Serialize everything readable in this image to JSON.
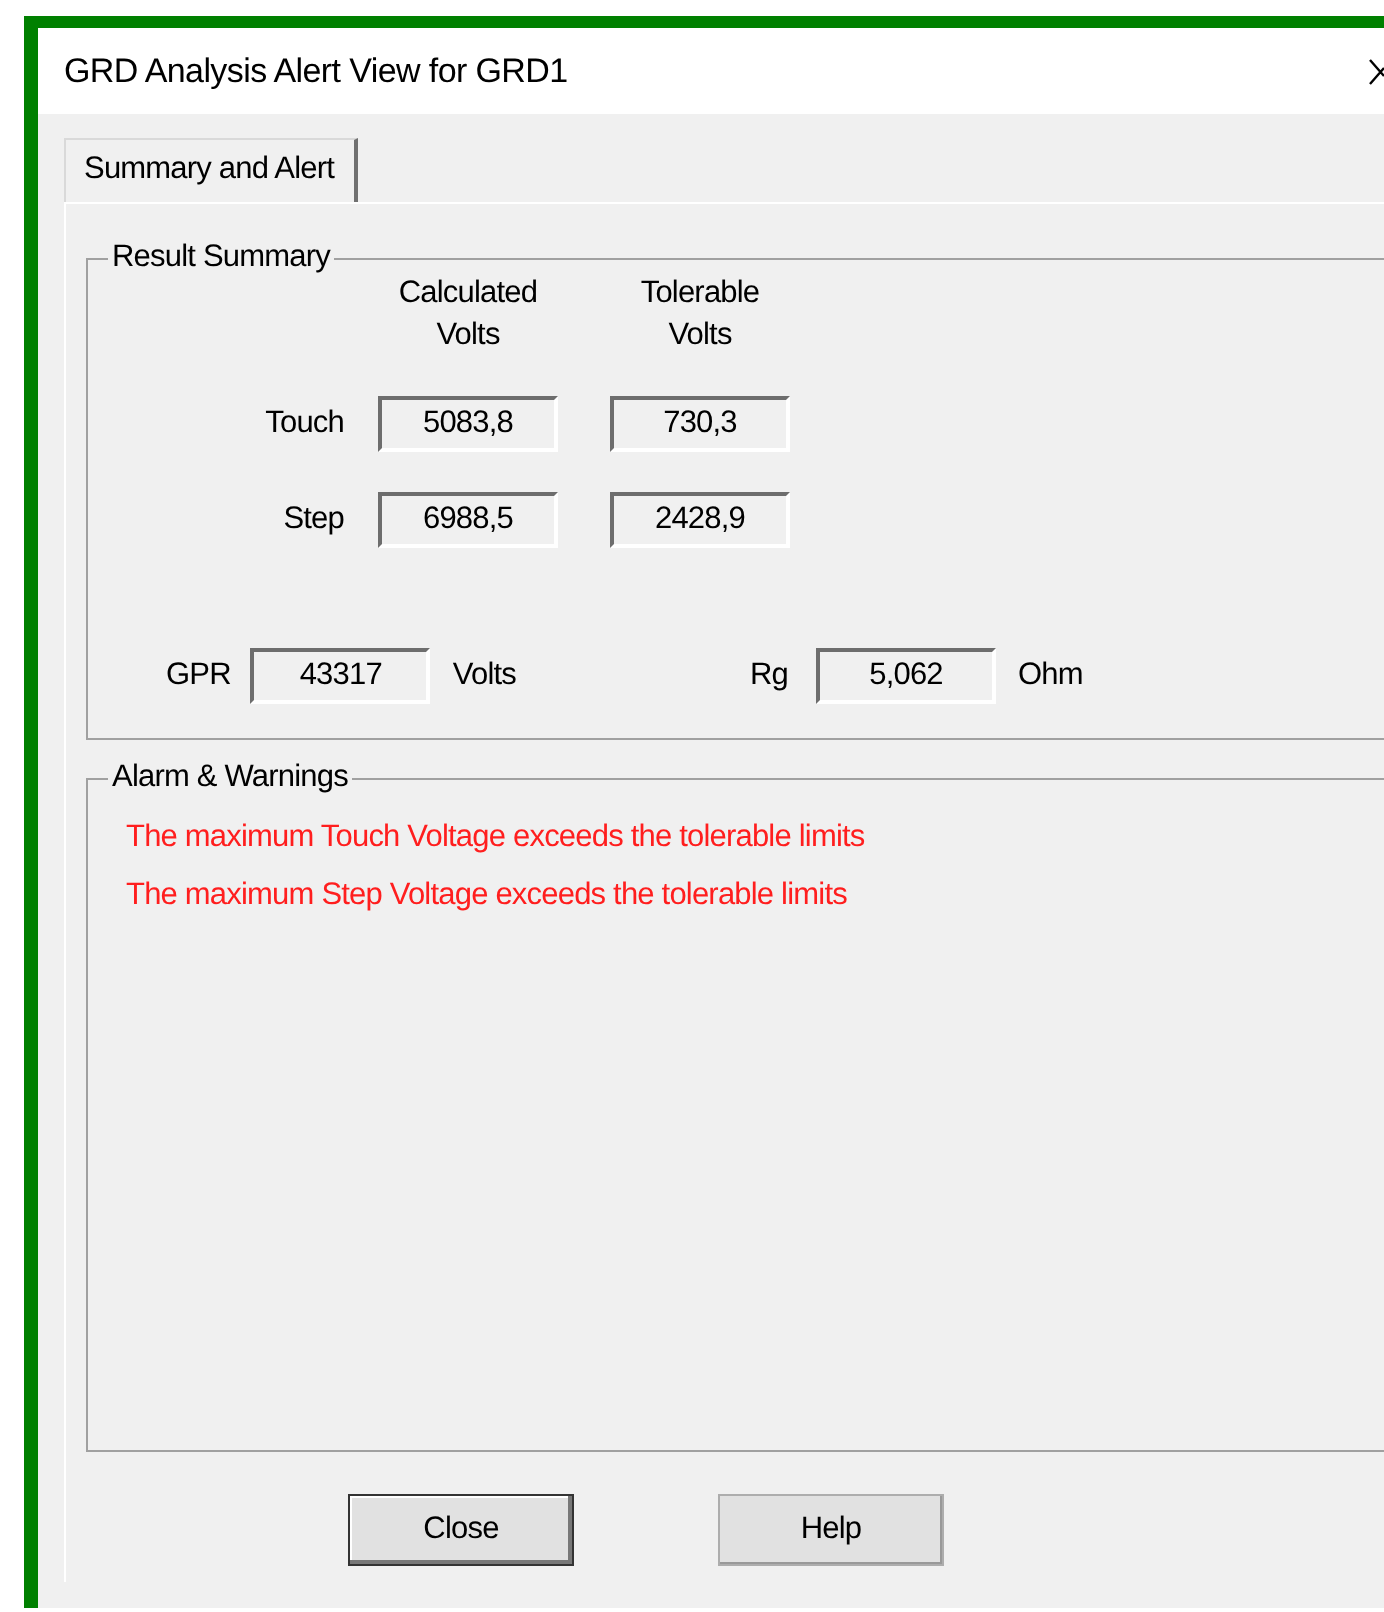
{
  "window": {
    "title": "GRD Analysis Alert View for GRD1"
  },
  "tabs": [
    {
      "label": "Summary and Alert",
      "selected": true
    }
  ],
  "result_summary": {
    "title": "Result Summary",
    "columns": [
      {
        "line1": "Calculated",
        "line2": "Volts"
      },
      {
        "line1": "Tolerable",
        "line2": "Volts"
      }
    ],
    "rows": [
      {
        "label": "Touch",
        "calculated": "5083,8",
        "tolerable": "730,3"
      },
      {
        "label": "Step",
        "calculated": "6988,5",
        "tolerable": "2428,9"
      }
    ],
    "gpr": {
      "label": "GPR",
      "value": "43317",
      "unit": "Volts"
    },
    "rg": {
      "label": "Rg",
      "value": "5,062",
      "unit": "Ohm"
    }
  },
  "alarms": {
    "title": "Alarm & Warnings",
    "messages": [
      "The maximum Touch Voltage exceeds the tolerable limits",
      "The maximum Step Voltage exceeds the tolerable limits"
    ]
  },
  "buttons": [
    {
      "label": "Close",
      "default": true
    },
    {
      "label": "Help",
      "default": false
    }
  ]
}
